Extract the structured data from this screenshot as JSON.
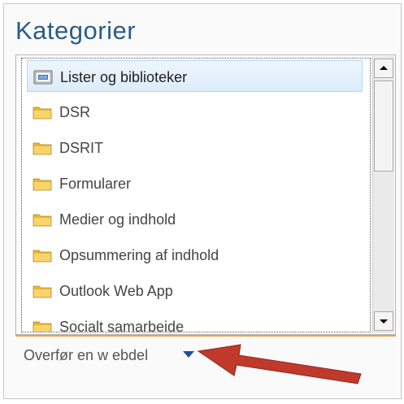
{
  "panel": {
    "title": "Kategorier"
  },
  "categories": {
    "selected_index": 0,
    "items": [
      {
        "label": "Lister og biblioteker",
        "icon": "list-library-icon"
      },
      {
        "label": "DSR",
        "icon": "folder-icon"
      },
      {
        "label": "DSRIT",
        "icon": "folder-icon"
      },
      {
        "label": "Formularer",
        "icon": "folder-icon"
      },
      {
        "label": "Medier og indhold",
        "icon": "folder-icon"
      },
      {
        "label": "Opsummering af indhold",
        "icon": "folder-icon"
      },
      {
        "label": "Outlook Web App",
        "icon": "folder-icon"
      },
      {
        "label": "Socialt samarbeide",
        "icon": "folder-icon"
      }
    ]
  },
  "footer": {
    "upload_link_label": "Overfør en w ebdel",
    "caret_icon": "caret-down-icon"
  },
  "colors": {
    "title": "#2b5c86",
    "accent_line": "#f3a33a",
    "caret": "#1f4fa3",
    "annotation_arrow": "#c0392b",
    "folder": "#f5c64a"
  }
}
